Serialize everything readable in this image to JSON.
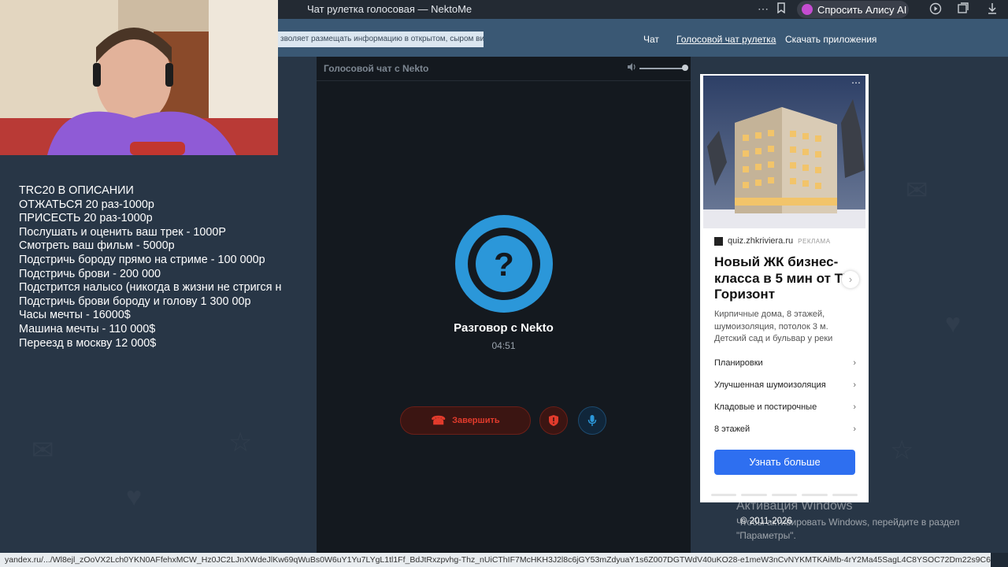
{
  "browser": {
    "tab_title": "Чат рулетка голосовая — NektoMe",
    "alice_label": "Спросить Алису AI"
  },
  "site": {
    "notice": "зволяет размещать информацию в открытом, сыром виде!",
    "nav": [
      "Чат",
      "Голосовой чат рулетка",
      "Скачать приложения"
    ]
  },
  "overlay": {
    "lines": [
      "TRC20 В ОПИСАНИИ",
      "ОТЖАТЬСЯ 20 раз-1000р",
      "ПРИСЕСТЬ 20 раз-1000р",
      "Послушать и оценить ваш трек - 1000Р",
      "Смотреть ваш фильм - 5000р",
      "Подстричь бороду прямо на стриме - 100 000р",
      "Подстричь брови - 200 000",
      "Подстрится налысо (никогда в жизни не стригся н",
      "Подстричь брови бороду и голову 1 300 00р",
      "Часы мечты - 16000$",
      "Машина мечты - 110 000$",
      "Переезд в москву 12 000$"
    ]
  },
  "chat": {
    "header_title": "Голосовой чат с Nekto",
    "volume_level": 1.0,
    "talk_label": "Разговор с Nekto",
    "timer": "04:51",
    "end_label": "Завершить",
    "colors": {
      "accent": "#2b97d9",
      "danger": "#e23b2c"
    }
  },
  "ad": {
    "domain": "quiz.zhkriviera.ru",
    "tag": "РЕКЛАМА",
    "title": "Новый ЖК бизнес-\nкласса в 5 мин от ТЦ\nГоризонт",
    "description": "Кирпичные дома, 8 этажей, шумоизоляция, потолок 3 м. Детский сад и бульвар у реки",
    "items": [
      "Планировки",
      "Улучшенная шумоизоляция",
      "Кладовые и постирочные",
      "8 этажей"
    ],
    "cta": "Узнать больше",
    "cta_color": "#2e6ff0"
  },
  "windows": {
    "activation_title": "Активация Windows",
    "activation_text": "Чтобы активировать Windows, перейдите в раздел \"Параметры\".",
    "copyright": "© 2011-2026"
  },
  "status_url": "yandex.ru/.../Wl8ejl_zOoVX2Lch0YKN0AFfehxMCW_Hz0JC2LJnXWdeJlKw69qWuBs0W6uY1Yu7LYgL1tl1Ff_BdJtRxzpvhg-Thz_nUiCThIF7McHKH3J2l8c6jGY53mZdyuaY1s6Z007DGTWdV40uKO28-e1meW3nCvNYKMTKAiMb-4rY2Ma45SagL4C8YSOC72Dm22s9C6G7JDbSmOGBL"
}
